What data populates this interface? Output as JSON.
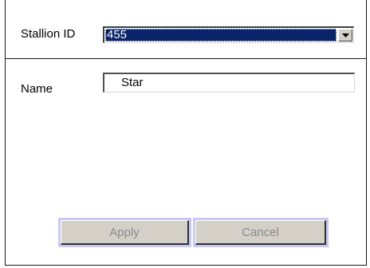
{
  "form": {
    "stallion_id": {
      "label": "Stallion ID",
      "selected_value": "455"
    },
    "name": {
      "label": "Name",
      "value": "Star"
    }
  },
  "actions": {
    "apply_label": "Apply",
    "cancel_label": "Cancel",
    "enabled": false
  },
  "colors": {
    "selection_bg": "#0a246a",
    "button_face": "#d4d0c8",
    "disabled_text": "#8a8a8a",
    "button_highlight": "#c8c8f0"
  },
  "icons": {
    "dropdown": "chevron-down-icon"
  }
}
